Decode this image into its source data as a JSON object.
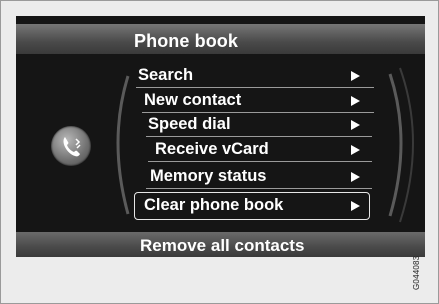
{
  "screen": {
    "title": "Phone book",
    "footer": "Remove all contacts",
    "menu": [
      {
        "label": "Search"
      },
      {
        "label": "New contact"
      },
      {
        "label": "Speed dial"
      },
      {
        "label": "Receive vCard"
      },
      {
        "label": "Memory status"
      },
      {
        "label": "Clear phone book",
        "selected": true
      }
    ]
  },
  "reference_code": "G044083",
  "colors": {
    "screen_background": "#151515",
    "text": "#ffffff",
    "selection_border": "#e6e6e6"
  },
  "icons": {
    "left_badge": "phone-icon",
    "row_indicator": "triangle-right-icon"
  }
}
